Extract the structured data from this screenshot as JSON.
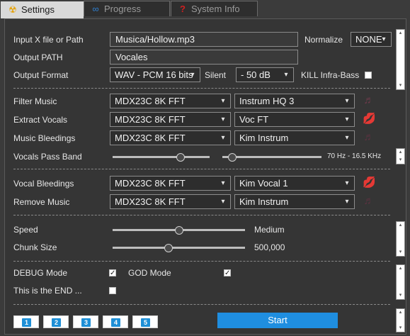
{
  "tabs": [
    {
      "label": "Settings",
      "icon": "radiation-icon",
      "glyph": "☢",
      "active": true
    },
    {
      "label": "Progress",
      "icon": "infinity-icon",
      "glyph": "∞",
      "active": false
    },
    {
      "label": "System Info",
      "icon": "question-icon",
      "glyph": "?",
      "active": false
    }
  ],
  "files": {
    "input_label": "Input X file or Path",
    "input_value": "Musica/Hollow.mp3",
    "output_path_label": "Output PATH",
    "output_path_value": "Vocales",
    "output_format_label": "Output Format",
    "output_format_value": "WAV - PCM 16 bits",
    "normalize_label": "Normalize",
    "normalize_value": "NONE",
    "silent_label": "Silent",
    "silent_value": "- 50 dB",
    "kill_infra_label": "KILL Infra-Bass",
    "kill_infra_checked": false
  },
  "music": {
    "filter_music_label": "Filter Music",
    "filter_music_model": "MDX23C 8K FFT",
    "filter_music_model2": "Instrum HQ 3",
    "extract_vocals_label": "Extract Vocals",
    "extract_vocals_model": "MDX23C 8K FFT",
    "extract_vocals_model2": "Voc FT",
    "music_bleedings_label": "Music Bleedings",
    "music_bleedings_model": "MDX23C 8K FFT",
    "music_bleedings_model2": "Kim Instrum",
    "vocals_pass_band_label": "Vocals Pass Band",
    "vocals_pass_band_value": "70 Hz - 16.5 KHz",
    "pass_band_low_level": 0.7,
    "pass_band_high_level": 0.1
  },
  "vocals": {
    "vocal_bleedings_label": "Vocal Bleedings",
    "vocal_bleedings_model": "MDX23C 8K FFT",
    "vocal_bleedings_model2": "Kim Vocal 1",
    "remove_music_label": "Remove Music",
    "remove_music_model": "MDX23C 8K FFT",
    "remove_music_model2": "Kim Instrum"
  },
  "performance": {
    "speed_label": "Speed",
    "speed_value": "Medium",
    "speed_level": 0.5,
    "chunk_size_label": "Chunk Size",
    "chunk_size_value": "500,000",
    "chunk_level": 0.42
  },
  "debug": {
    "debug_mode_label": "DEBUG Mode",
    "debug_mode_checked": true,
    "god_mode_label": "GOD Mode",
    "god_mode_checked": true,
    "end_label": "This is the END ...",
    "end_checked": false
  },
  "footer": {
    "buttons": [
      "1",
      "2",
      "3",
      "4",
      "5"
    ],
    "start_label": "Start"
  },
  "colors": {
    "accent_blue": "#1f8ee0",
    "lips_active": "#e0245e",
    "lips_inactive": "#6e3040",
    "note_inactive": "#6b3a4a"
  },
  "glyphs": {
    "check": "✓",
    "arrow_down": "▾",
    "arrow_up": "▴",
    "note": "♬",
    "lips": "💋"
  }
}
